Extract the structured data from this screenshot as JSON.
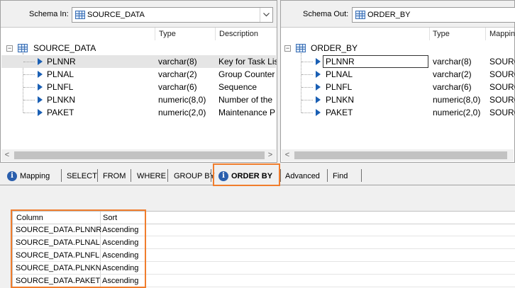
{
  "schema_in": {
    "label": "Schema In:",
    "selected": "SOURCE_DATA",
    "columns": [
      "Type",
      "Description"
    ],
    "root": "SOURCE_DATA",
    "fields": [
      {
        "name": "PLNNR",
        "type": "varchar(8)",
        "description": "Key for Task List"
      },
      {
        "name": "PLNAL",
        "type": "varchar(2)",
        "description": "Group Counter"
      },
      {
        "name": "PLNFL",
        "type": "varchar(6)",
        "description": "Sequence"
      },
      {
        "name": "PLNKN",
        "type": "numeric(8,0)",
        "description": "Number of the"
      },
      {
        "name": "PAKET",
        "type": "numeric(2,0)",
        "description": "Maintenance P"
      }
    ]
  },
  "schema_out": {
    "label": "Schema Out:",
    "selected": "ORDER_BY",
    "columns": [
      "Type",
      "Mappin"
    ],
    "root": "ORDER_BY",
    "fields": [
      {
        "name": "PLNNR",
        "type": "varchar(8)",
        "mapping": "SOURCE"
      },
      {
        "name": "PLNAL",
        "type": "varchar(2)",
        "mapping": "SOURCE"
      },
      {
        "name": "PLNFL",
        "type": "varchar(6)",
        "mapping": "SOURCE"
      },
      {
        "name": "PLNKN",
        "type": "numeric(8,0)",
        "mapping": "SOURCE"
      },
      {
        "name": "PAKET",
        "type": "numeric(2,0)",
        "mapping": "SOURCE"
      }
    ]
  },
  "tabs": [
    {
      "label": "Mapping"
    },
    {
      "label": "SELECT"
    },
    {
      "label": "FROM"
    },
    {
      "label": "WHERE"
    },
    {
      "label": "GROUP BY"
    },
    {
      "label": "ORDER BY"
    },
    {
      "label": "Advanced"
    },
    {
      "label": "Find"
    }
  ],
  "order_by": {
    "headers": {
      "column": "Column",
      "sort": "Sort"
    },
    "rows": [
      {
        "column": "SOURCE_DATA.PLNNR",
        "sort": "Ascending"
      },
      {
        "column": "SOURCE_DATA.PLNAL",
        "sort": "Ascending"
      },
      {
        "column": "SOURCE_DATA.PLNFL",
        "sort": "Ascending"
      },
      {
        "column": "SOURCE_DATA.PLNKN",
        "sort": "Ascending"
      },
      {
        "column": "SOURCE_DATA.PAKET",
        "sort": "Ascending"
      }
    ]
  },
  "colors": {
    "accent": "#f07d2d",
    "arrow": "#1a5fb4",
    "info": "#2b5fad"
  },
  "icons": [
    "table-icon",
    "dropdown-arrow-icon",
    "field-arrow-icon",
    "info-icon",
    "expand-icon"
  ]
}
